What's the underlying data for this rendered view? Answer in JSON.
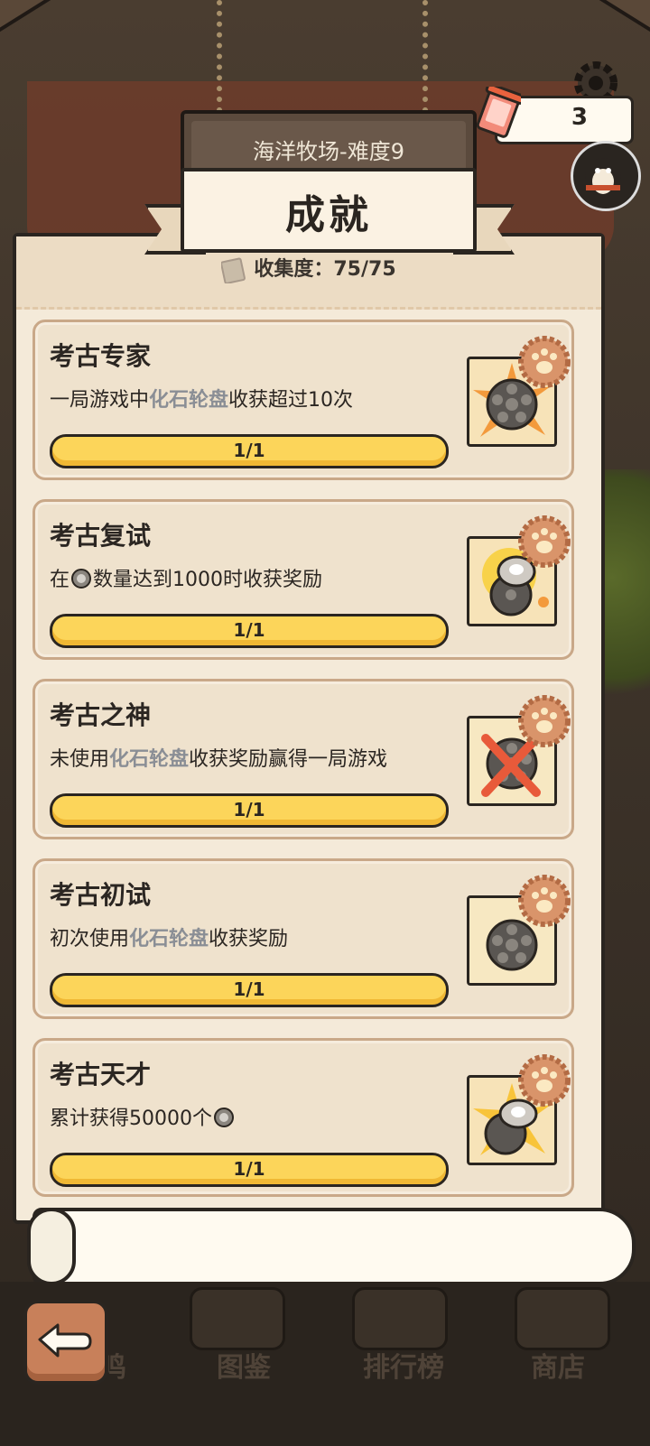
{
  "header": {
    "level_title": "海洋牧场-难度9",
    "ticket_count": "3"
  },
  "panel": {
    "title": "成就",
    "collection_label": "收集度：75/75"
  },
  "achievements": [
    {
      "title": "考古专家",
      "desc_before": "一局游戏中",
      "desc_highlight": "化石轮盘",
      "desc_after": "收获超过10次",
      "progress": "1/1",
      "progress_fraction": 1.0
    },
    {
      "title": "考古复试",
      "desc_before": "在",
      "desc_after": "数量达到1000时收获奖励",
      "progress": "1/1",
      "progress_fraction": 1.0
    },
    {
      "title": "考古之神",
      "desc_before": "未使用",
      "desc_highlight": "化石轮盘",
      "desc_after": "收获奖励赢得一局游戏",
      "progress": "1/1",
      "progress_fraction": 1.0
    },
    {
      "title": "考古初试",
      "desc_before": "初次使用",
      "desc_highlight": "化石轮盘",
      "desc_after": "收获奖励",
      "progress": "1/1",
      "progress_fraction": 1.0
    },
    {
      "title": "考古天才",
      "desc_before": "累计获得50000个",
      "desc_after": "",
      "progress": "1/1",
      "progress_fraction": 1.0
    }
  ],
  "nav": {
    "items": [
      "图鉴",
      "排行榜",
      "商店"
    ],
    "partial_item": "鸣"
  },
  "colors": {
    "progress_fill": "#fcd55a",
    "highlight_text": "#8a8e95",
    "panel_bg": "#f4ead9",
    "back_button": "#c8805a"
  }
}
